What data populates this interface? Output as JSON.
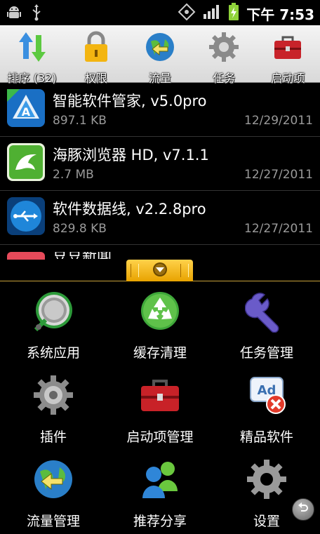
{
  "status_bar": {
    "time": "下午 7:53",
    "icons": [
      "android-debug-icon",
      "usb-icon",
      "gps-icon",
      "signal-icon",
      "battery-charging-icon"
    ]
  },
  "toolbar": {
    "items": [
      {
        "label": "排序 (32)",
        "icon": "sort-arrows-icon"
      },
      {
        "label": "权限",
        "icon": "padlock-icon"
      },
      {
        "label": "流量",
        "icon": "globe-arrow-icon"
      },
      {
        "label": "任务",
        "icon": "gear-icon"
      },
      {
        "label": "启动项",
        "icon": "toolbox-icon"
      }
    ]
  },
  "apps": [
    {
      "name": "智能软件管家, v5.0pro",
      "size": "897.1 KB",
      "date": "12/29/2011",
      "icon": "app-manager-icon"
    },
    {
      "name": "海豚浏览器 HD, v7.1.1",
      "size": "2.7 MB",
      "date": "12/27/2011",
      "icon": "dolphin-icon"
    },
    {
      "name": "软件数据线, v2.2.8pro",
      "size": "829.8 KB",
      "date": "12/27/2011",
      "icon": "usb-data-icon"
    }
  ],
  "partial_app": {
    "name": "豆豆新闻"
  },
  "menu": {
    "items": [
      {
        "label": "系统应用",
        "icon": "system-app-icon"
      },
      {
        "label": "缓存清理",
        "icon": "recycle-icon"
      },
      {
        "label": "任务管理",
        "icon": "wrench-icon"
      },
      {
        "label": "插件",
        "icon": "plugin-gear-icon"
      },
      {
        "label": "启动项管理",
        "icon": "startup-toolbox-icon"
      },
      {
        "label": "精品软件",
        "icon": "premium-software-icon"
      },
      {
        "label": "流量管理",
        "icon": "traffic-globe-icon"
      },
      {
        "label": "推荐分享",
        "icon": "share-people-icon"
      },
      {
        "label": "设置",
        "icon": "settings-gear-icon"
      }
    ]
  },
  "colors": {
    "toolbar_bg": "#e6e6e6",
    "panel_handle": "#f2b300",
    "secondary_text": "#9a9a9a"
  }
}
